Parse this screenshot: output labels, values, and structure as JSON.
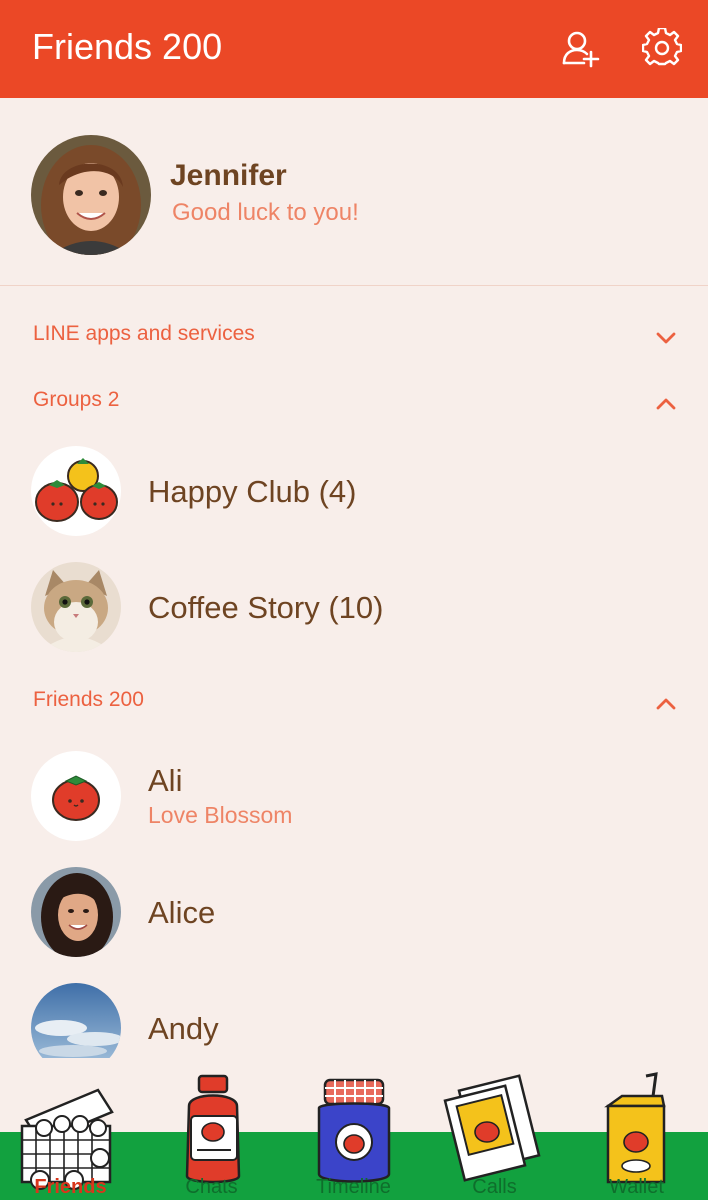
{
  "header": {
    "title": "Friends 200",
    "add_friend_icon": "add-friend-icon",
    "settings_icon": "gear-icon"
  },
  "profile": {
    "name": "Jennifer",
    "status": "Good luck to you!"
  },
  "sections": {
    "services": {
      "label": "LINE apps and services",
      "state": "collapsed"
    },
    "groups": {
      "label": "Groups 2",
      "state": "expanded"
    },
    "friends": {
      "label": "Friends 200",
      "state": "expanded"
    }
  },
  "groups": [
    {
      "name": "Happy Club (4)"
    },
    {
      "name": "Coffee Story (10)"
    }
  ],
  "friends": [
    {
      "name": "Ali",
      "status": "Love Blossom"
    },
    {
      "name": "Alice"
    },
    {
      "name": "Andy"
    }
  ],
  "tabs": [
    {
      "label": "Friends",
      "active": true
    },
    {
      "label": "Chats"
    },
    {
      "label": "Timeline"
    },
    {
      "label": "Calls"
    },
    {
      "label": "Wallet"
    }
  ],
  "colors": {
    "header": "#eb4826",
    "background": "#f8eeea",
    "accent": "#ec6140",
    "text": "#6e4422",
    "status": "#ee8466",
    "tabbar": "#12a13f"
  }
}
